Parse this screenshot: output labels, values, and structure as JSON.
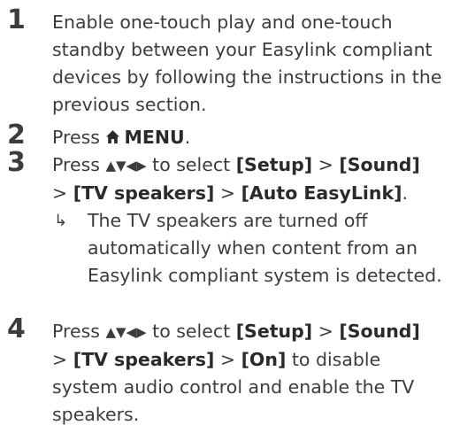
{
  "steps": [
    {
      "num": "1",
      "text": "Enable one-touch play and one-touch standby between your Easylink compliant devices by following the instructions in the previous section."
    },
    {
      "num": "2",
      "prefix": "Press ",
      "key": "MENU",
      "suffix": ".",
      "icon": "home-icon"
    },
    {
      "num": "3",
      "prefix": "Press ",
      "arrows": "▲▼◀▶",
      "mid": " to select ",
      "path": [
        {
          "label": "[Setup]",
          "sep": " > "
        },
        {
          "label": "[Sound]",
          "sep": ""
        },
        {
          "label": "[TV speakers]",
          "sep": " > ",
          "lead": "> "
        },
        {
          "label": "[Auto EasyLink]",
          "sep": "."
        }
      ],
      "result_arrow": "↳",
      "result": "The TV speakers are turned off automatically when content from an Easylink compliant system is detected."
    },
    {
      "num": "4",
      "prefix": "Press ",
      "arrows": "▲▼◀▶",
      "mid": " to select ",
      "path": [
        {
          "label": "[Setup]",
          "sep": " > "
        },
        {
          "label": "[Sound]",
          "sep": ""
        },
        {
          "label": "[TV speakers]",
          "sep": " > ",
          "lead": "> "
        },
        {
          "label": "[On]",
          "sep": ""
        }
      ],
      "tail": " to disable system audio control and enable the TV speakers."
    }
  ]
}
